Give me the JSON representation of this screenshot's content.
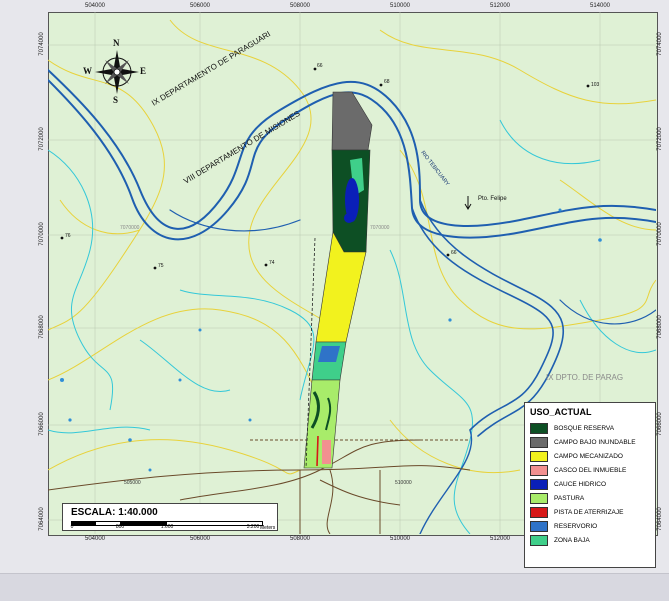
{
  "map": {
    "x_ticks": [
      "504000",
      "506000",
      "508000",
      "510000",
      "512000",
      "514000"
    ],
    "y_ticks": [
      "7074000",
      "7072000",
      "7070000",
      "7068000",
      "7066000",
      "7064000"
    ],
    "inner_easting_labels": [
      "505000",
      "510000"
    ],
    "inner_northing_labels": [
      "7070000",
      "7070000"
    ],
    "labels": {
      "dept_paraguari": "IX DEPARTAMENTO DE PARAGUARI",
      "dept_misiones": "VIII DEPARTAMENTO DE MISIONES",
      "river": "RIO TEBICUARY",
      "pto_felipe": "Pto. Felipe",
      "faded_dept": "IX DPTO. DE PARAG"
    },
    "spot_heights": [
      "66",
      "68",
      "103",
      "76",
      "75",
      "74",
      "66"
    ],
    "compass": {
      "n": "N",
      "s": "S",
      "e": "E",
      "w": "W"
    }
  },
  "legend": {
    "title": "USO_ACTUAL",
    "items": [
      {
        "label": "BOSQUE RESERVA",
        "color": "#0d4f24"
      },
      {
        "label": "CAMPO BAJO INUNDABLE",
        "color": "#6b6b6b"
      },
      {
        "label": "CAMPO MECANIZADO",
        "color": "#f2f21e"
      },
      {
        "label": "CASCO DEL INMUEBLE",
        "color": "#f29090"
      },
      {
        "label": "CAUCE  HIDRICO",
        "color": "#0a1fb8"
      },
      {
        "label": "PASTURA",
        "color": "#a8ec6a"
      },
      {
        "label": "PISTA DE ATERRIZAJE",
        "color": "#d61818"
      },
      {
        "label": "RESERVORIO",
        "color": "#2f73c8"
      },
      {
        "label": "ZONA BAJA",
        "color": "#3fcf8a"
      }
    ]
  },
  "scale": {
    "title": "ESCALA: 1:40.000",
    "ticks": [
      "0",
      "800",
      "1.600",
      "3.200"
    ],
    "unit": "Meters"
  },
  "colors": {
    "background": "#dff1d5",
    "river": "#1f5fb0",
    "contour_yellow": "#e8d23a",
    "contour_cyan": "#34c8d8",
    "road": "#6a4a2a"
  }
}
